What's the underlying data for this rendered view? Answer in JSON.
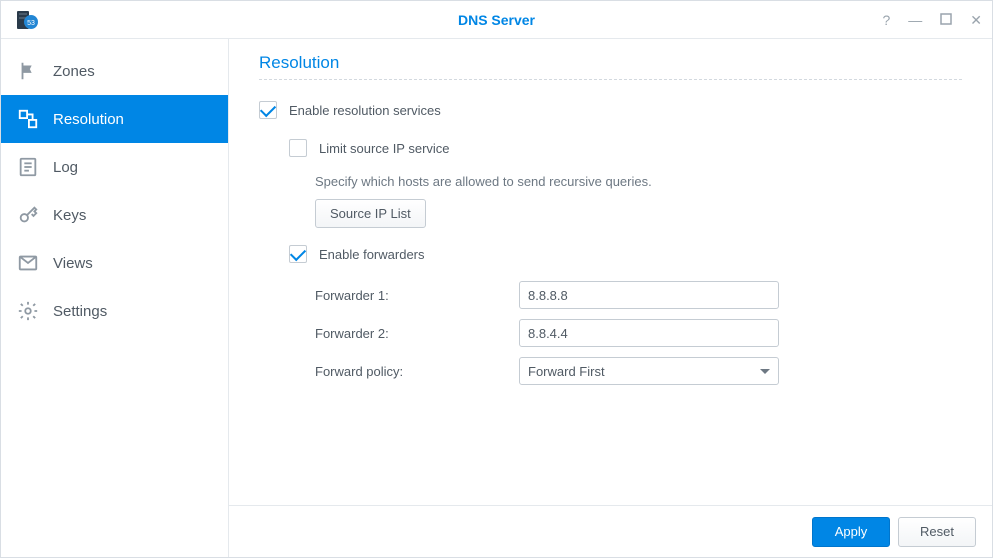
{
  "window": {
    "title": "DNS Server"
  },
  "sidebar": {
    "items": [
      {
        "label": "Zones"
      },
      {
        "label": "Resolution"
      },
      {
        "label": "Log"
      },
      {
        "label": "Keys"
      },
      {
        "label": "Views"
      },
      {
        "label": "Settings"
      }
    ]
  },
  "section": {
    "title": "Resolution",
    "enable_resolution_label": "Enable resolution services",
    "limit_source_ip_label": "Limit source IP service",
    "limit_source_ip_help": "Specify which hosts are allowed to send recursive queries.",
    "source_ip_list_btn": "Source IP List",
    "enable_forwarders_label": "Enable forwarders",
    "forwarder1_label": "Forwarder 1:",
    "forwarder1_value": "8.8.8.8",
    "forwarder2_label": "Forwarder 2:",
    "forwarder2_value": "8.8.4.4",
    "forward_policy_label": "Forward policy:",
    "forward_policy_value": "Forward First"
  },
  "footer": {
    "apply": "Apply",
    "reset": "Reset"
  }
}
